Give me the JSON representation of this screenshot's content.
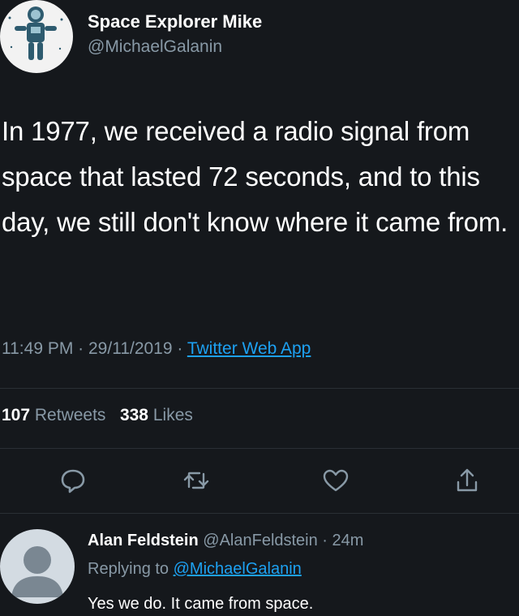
{
  "tweet": {
    "author": {
      "display_name": "Space Explorer Mike",
      "handle": "@MichaelGalanin",
      "avatar_icon": "astronaut-avatar-icon"
    },
    "text": "In 1977, we received a radio signal from space that lasted 72 seconds, and to this day, we still don't know where it came from.",
    "time": "11:49 PM",
    "date": "29/11/2019",
    "separator": " · ",
    "source": "Twitter Web App",
    "retweets_count": "107",
    "retweets_label": "Retweets",
    "likes_count": "338",
    "likes_label": "Likes",
    "actions": [
      "reply-icon",
      "retweet-icon",
      "like-icon",
      "share-icon"
    ]
  },
  "reply": {
    "display_name": "Alan Feldstein",
    "handle": "@AlanFeldstein",
    "separator": " · ",
    "time_ago": "24m",
    "replying_label": "Replying to",
    "replying_to": "@MichaelGalanin",
    "text": "Yes we do. It came from space."
  },
  "colors": {
    "background": "#15181c",
    "text": "#ffffff",
    "secondary": "#8899a6",
    "link": "#1da1f2"
  }
}
